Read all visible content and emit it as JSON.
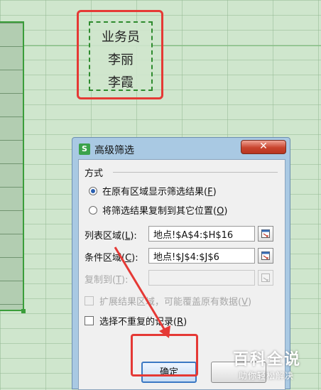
{
  "spreadsheet": {
    "criteria_cells": [
      "业务员",
      "李丽",
      "李霞"
    ]
  },
  "dialog": {
    "title": "高级筛选",
    "app_icon_glyph": "S",
    "close_glyph": "✕",
    "method_group_label": "方式",
    "options": [
      {
        "label": "在原有区域显示筛选结果(",
        "hotkey": "F",
        "suffix": ")",
        "checked": true
      },
      {
        "label": "将筛选结果复制到其它位置(",
        "hotkey": "O",
        "suffix": ")",
        "checked": false
      }
    ],
    "list_range": {
      "label": "列表区域(",
      "hotkey": "L",
      "suffix": "):",
      "value": "地点!$A$4:$H$16"
    },
    "criteria_range": {
      "label": "条件区域(",
      "hotkey": "C",
      "suffix": "):",
      "value": "地点!$J$4:$J$6"
    },
    "copy_to": {
      "label": "复制到(",
      "hotkey": "T",
      "suffix": "):",
      "value": "",
      "enabled": false
    },
    "expand_results": {
      "label": "扩展结果区域，可能覆盖原有数据(",
      "hotkey": "V",
      "suffix": ")",
      "checked": false,
      "enabled": false
    },
    "unique_records": {
      "label": "选择不重复的记录(",
      "hotkey": "R",
      "suffix": ")",
      "checked": false
    },
    "ok_label": "确定",
    "cancel_label": ""
  },
  "watermark": {
    "title": "百科全说",
    "subtitle": "助你轻松解决"
  },
  "colors": {
    "sheet_bg": "#cfe6cd",
    "dialog_frame": "#a9c9e3",
    "annotation": "#e53935",
    "selection": "#3a9e3a"
  }
}
